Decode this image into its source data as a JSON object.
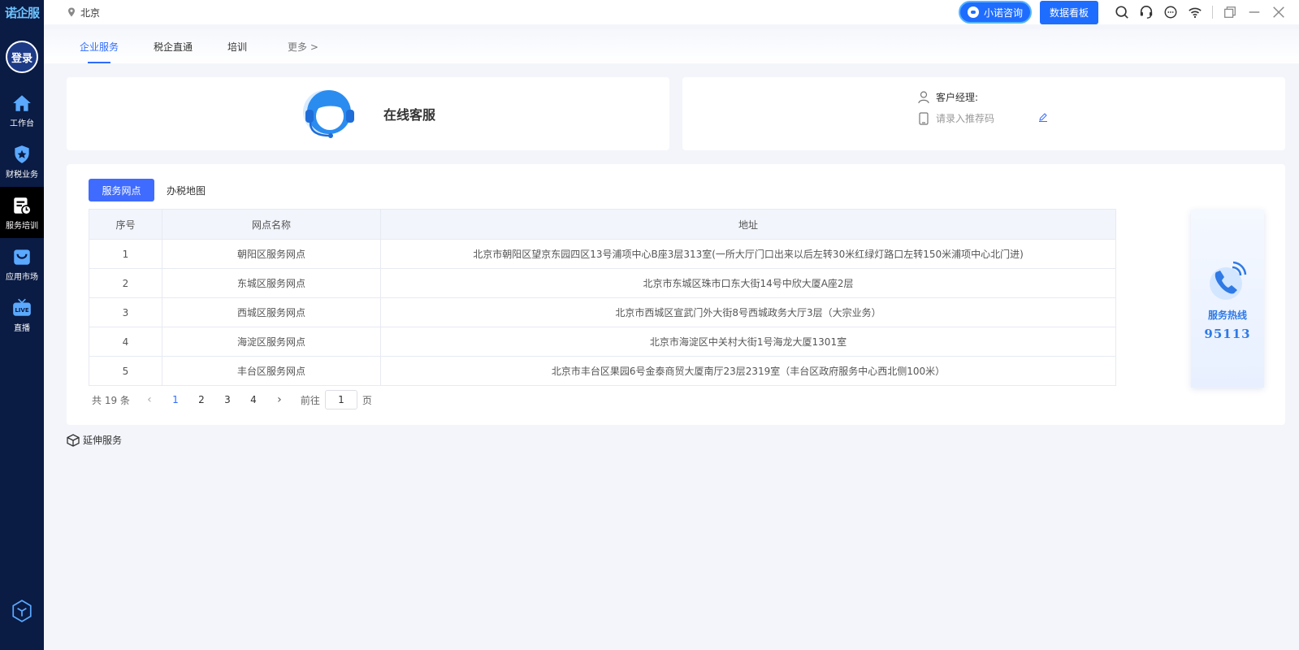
{
  "app": {
    "brand": "诺企服",
    "login": "登录"
  },
  "sidebar": {
    "items": [
      {
        "label": "工作台",
        "icon": "home-icon"
      },
      {
        "label": "财税业务",
        "icon": "tax-shield-icon"
      },
      {
        "label": "服务培训",
        "icon": "training-doc-icon"
      },
      {
        "label": "应用市场",
        "icon": "market-bag-icon"
      },
      {
        "label": "直播",
        "icon": "live-tv-icon"
      }
    ],
    "active_index": 2
  },
  "topbar": {
    "location": "北京",
    "consult_label": "小诺咨询",
    "board_label": "数据看板"
  },
  "tabs": [
    {
      "label": "企业服务"
    },
    {
      "label": "税企直通"
    },
    {
      "label": "培训"
    },
    {
      "label": "更多 >"
    }
  ],
  "service_card": {
    "title": "在线客服"
  },
  "manager_card": {
    "manager_label": "客户经理:",
    "referral_placeholder": "请录入推荐码"
  },
  "panel": {
    "segment_active": "服务网点",
    "segment_other": "办税地图",
    "columns": [
      "序号",
      "网点名称",
      "地址"
    ],
    "rows": [
      {
        "no": "1",
        "name": "朝阳区服务网点",
        "address": "北京市朝阳区望京东园四区13号浦项中心B座3层313室(一所大厅门口出来以后左转30米红绿灯路口左转150米浦项中心北门进)"
      },
      {
        "no": "2",
        "name": "东城区服务网点",
        "address": "北京市东城区珠市口东大街14号中欣大厦A座2层"
      },
      {
        "no": "3",
        "name": "西城区服务网点",
        "address": "北京市西城区宣武门外大街8号西城政务大厅3层（大宗业务）"
      },
      {
        "no": "4",
        "name": "海淀区服务网点",
        "address": "北京市海淀区中关村大街1号海龙大厦1301室"
      },
      {
        "no": "5",
        "name": "丰台区服务网点",
        "address": "北京市丰台区果园6号金泰商贸大厦南厅23层2319室（丰台区政府服务中心西北侧100米）"
      }
    ],
    "pagination": {
      "total": "共 19 条",
      "pages": [
        "1",
        "2",
        "3",
        "4"
      ],
      "current": "1",
      "goto_label": "前往",
      "goto_value": "1",
      "page_suffix": "页"
    }
  },
  "hotline": {
    "label": "服务热线",
    "number": "95113"
  },
  "extend": {
    "label": "延伸服务"
  },
  "colors": {
    "sidebar": "#0a1b44",
    "accent": "#2f6cff",
    "button": "#1f6dff"
  }
}
